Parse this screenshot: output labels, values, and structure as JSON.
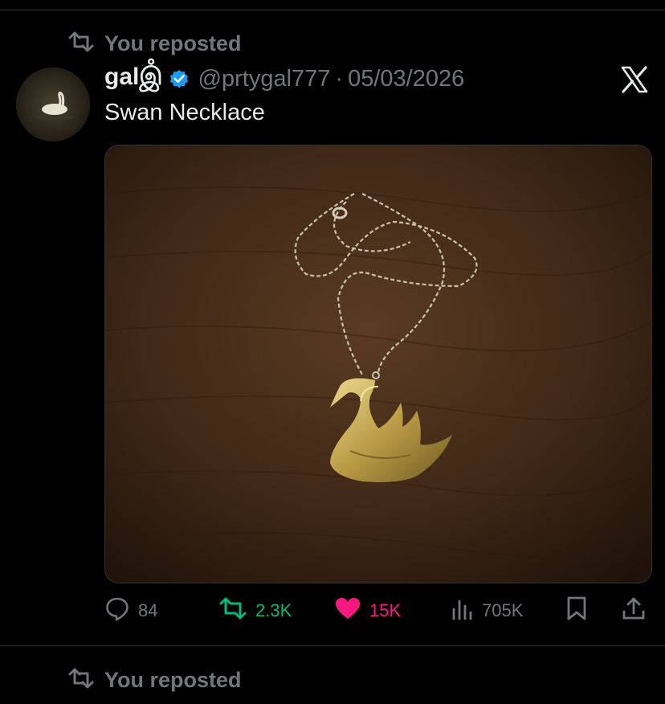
{
  "post": {
    "repost_label": "You reposted",
    "author_name": "galஇஂ",
    "author_handle": "@prtygal777",
    "separator": "·",
    "date": "05/03/2026",
    "text": "Swan Necklace",
    "media_alt": "Gold swan pendant on a chain lying on a wooden table"
  },
  "actions": {
    "replies": "84",
    "reposts": "2.3K",
    "likes": "15K",
    "views": "705K"
  },
  "next_post": {
    "repost_label": "You reposted"
  },
  "colors": {
    "background": "#000000",
    "muted": "#71767b",
    "verified": "#1d9bf0",
    "repost_active": "#00ba7c",
    "like_active": "#f91880"
  },
  "icons": [
    "repost-icon",
    "verified-badge-icon",
    "x-logo-icon",
    "reply-icon",
    "like-icon",
    "views-icon",
    "bookmark-icon",
    "share-icon"
  ]
}
